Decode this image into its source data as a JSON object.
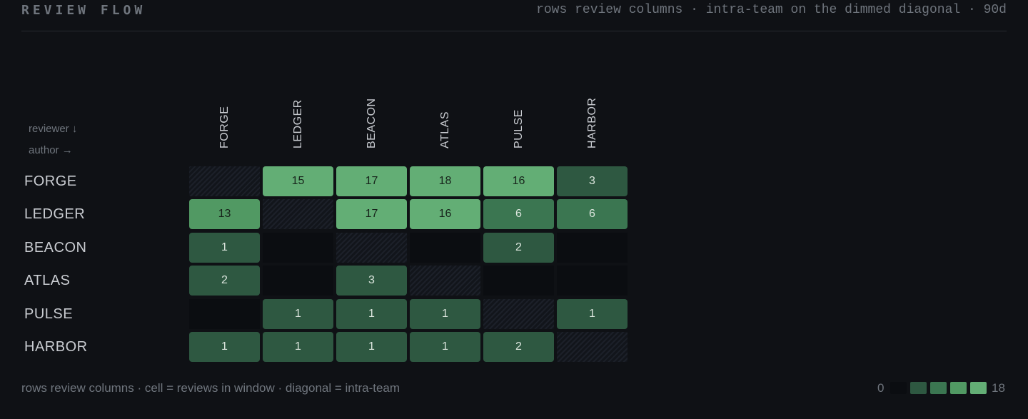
{
  "header": {
    "title": "REVIEW FLOW",
    "subtitle": "rows review columns · intra-team on the dimmed diagonal · 90d"
  },
  "axis_keys": {
    "reviewer": "reviewer ↓",
    "author": "author →"
  },
  "footer": {
    "note": "rows review columns · cell = reviews in window · diagonal = intra-team",
    "legend_min": "0",
    "legend_max": "18"
  },
  "colors": {
    "background": "#0f1115",
    "diagonal": "#1c2029",
    "empty": "#0b0d11",
    "scale": [
      "#0b0d11",
      "#2e5841",
      "#3b7651",
      "#519963",
      "#63ae75"
    ]
  },
  "chart_data": {
    "type": "heatmap",
    "rows": [
      "FORGE",
      "LEDGER",
      "BEACON",
      "ATLAS",
      "PULSE",
      "HARBOR"
    ],
    "columns": [
      "FORGE",
      "LEDGER",
      "BEACON",
      "ATLAS",
      "PULSE",
      "HARBOR"
    ],
    "values": [
      [
        null,
        15,
        17,
        18,
        16,
        3
      ],
      [
        13,
        null,
        17,
        16,
        6,
        6
      ],
      [
        1,
        0,
        null,
        0,
        2,
        0
      ],
      [
        2,
        0,
        3,
        null,
        0,
        0
      ],
      [
        0,
        1,
        1,
        1,
        null,
        1
      ],
      [
        1,
        1,
        1,
        1,
        2,
        null
      ]
    ],
    "range": [
      0,
      18
    ]
  }
}
